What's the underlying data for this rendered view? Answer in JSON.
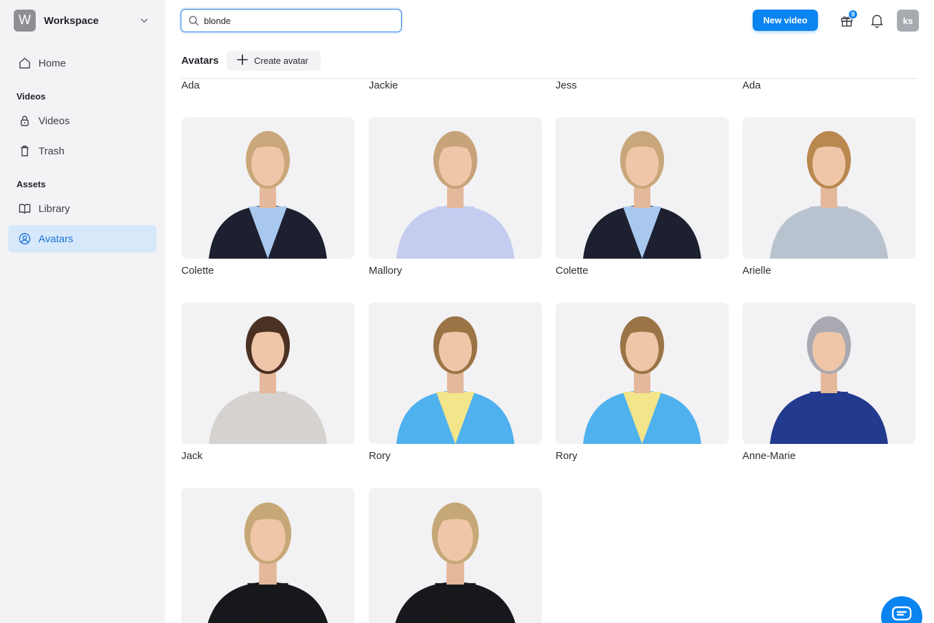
{
  "workspace": {
    "logo_letter": "W",
    "name": "Workspace"
  },
  "sidebar": {
    "home": "Home",
    "videos_section": "Videos",
    "videos": "Videos",
    "trash": "Trash",
    "assets_section": "Assets",
    "library": "Library",
    "avatars": "Avatars"
  },
  "topbar": {
    "search_value": "blonde",
    "new_video": "New video",
    "notification_count": "9",
    "user_initials": "ks"
  },
  "main": {
    "title": "Avatars",
    "create_avatar": "Create avatar",
    "partial_row": [
      "Ada",
      "Jackie",
      "Jess",
      "Ada"
    ],
    "avatars": [
      {
        "name": "Colette",
        "hair": "#c9a77a",
        "shirt": "#a9c8ee",
        "outer": "#1c2030"
      },
      {
        "name": "Mallory",
        "hair": "#c6a37a",
        "shirt": "#c4cdf0",
        "outer": "#c4cdf0"
      },
      {
        "name": "Colette",
        "hair": "#c9a77a",
        "shirt": "#a9c8ee",
        "outer": "#1c2030"
      },
      {
        "name": "Arielle",
        "hair": "#b9884f",
        "shirt": "#b9c3d0",
        "outer": "#b9c3d0"
      },
      {
        "name": "Jack",
        "hair": "#4a3122",
        "shirt": "#d6d2cf",
        "outer": "#d6d2cf"
      },
      {
        "name": "Rory",
        "hair": "#9b7446",
        "shirt": "#f3e58a",
        "outer": "#4fb1ee"
      },
      {
        "name": "Rory",
        "hair": "#9b7446",
        "shirt": "#f3e58a",
        "outer": "#4fb1ee"
      },
      {
        "name": "Anne-Marie",
        "hair": "#a9a9b1",
        "shirt": "#233b8e",
        "outer": "#233b8e"
      },
      {
        "name": "",
        "hair": "#c6a878",
        "shirt": "#17181b",
        "outer": "#17181b"
      },
      {
        "name": "",
        "hair": "#c6a878",
        "shirt": "#17181b",
        "outer": "#17181b"
      }
    ]
  },
  "colors": {
    "accent": "#0a84f0",
    "sidebar_bg": "#f3f3f6",
    "active_bg": "#d7e8fa"
  }
}
